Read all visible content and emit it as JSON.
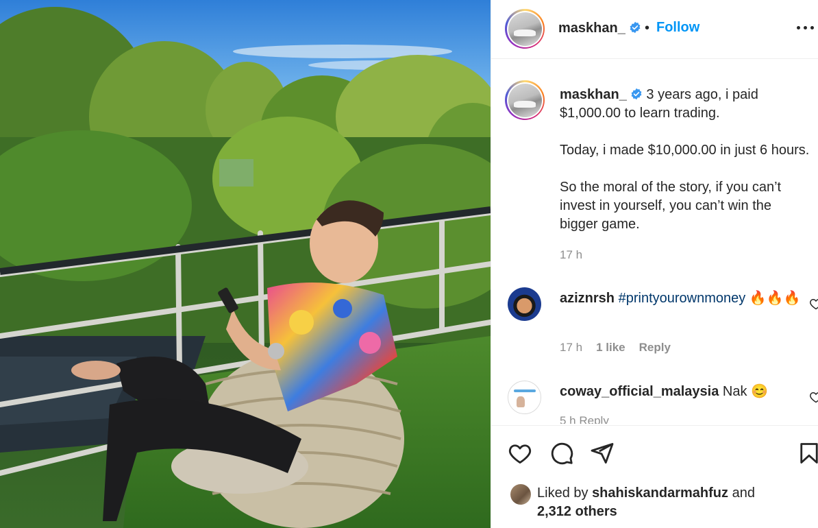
{
  "post": {
    "username": "maskhan_",
    "separator": "•",
    "follow_label": "Follow",
    "caption_username": "maskhan_",
    "caption_text": " 3 years ago, i paid\n$1,000.00 to learn trading.\n\nToday, i made $10,000.00 in just 6 hours.\n\nSo the moral of the story, if you can’t\ninvest in yourself, you can’t win the\nbigger game.",
    "caption_time": "17 h"
  },
  "comments": [
    {
      "username": "aziznrsh",
      "hashtag": "#printyourownmoney",
      "emoji": " 🔥🔥🔥",
      "time": "17 h",
      "likes": "1 like",
      "reply_label": "Reply"
    },
    {
      "username": "coway_official_malaysia",
      "text": " Nak 😊",
      "partial_meta": "5 h   Reply"
    }
  ],
  "likes": {
    "prefix": "Liked by ",
    "user": "shahiskandarmahfuz",
    "suffix": " and",
    "others": "2,312 others"
  },
  "colors": {
    "accent": "#0095f6",
    "text": "#262626",
    "muted": "#8e8e8e",
    "hashtag": "#00376b"
  }
}
